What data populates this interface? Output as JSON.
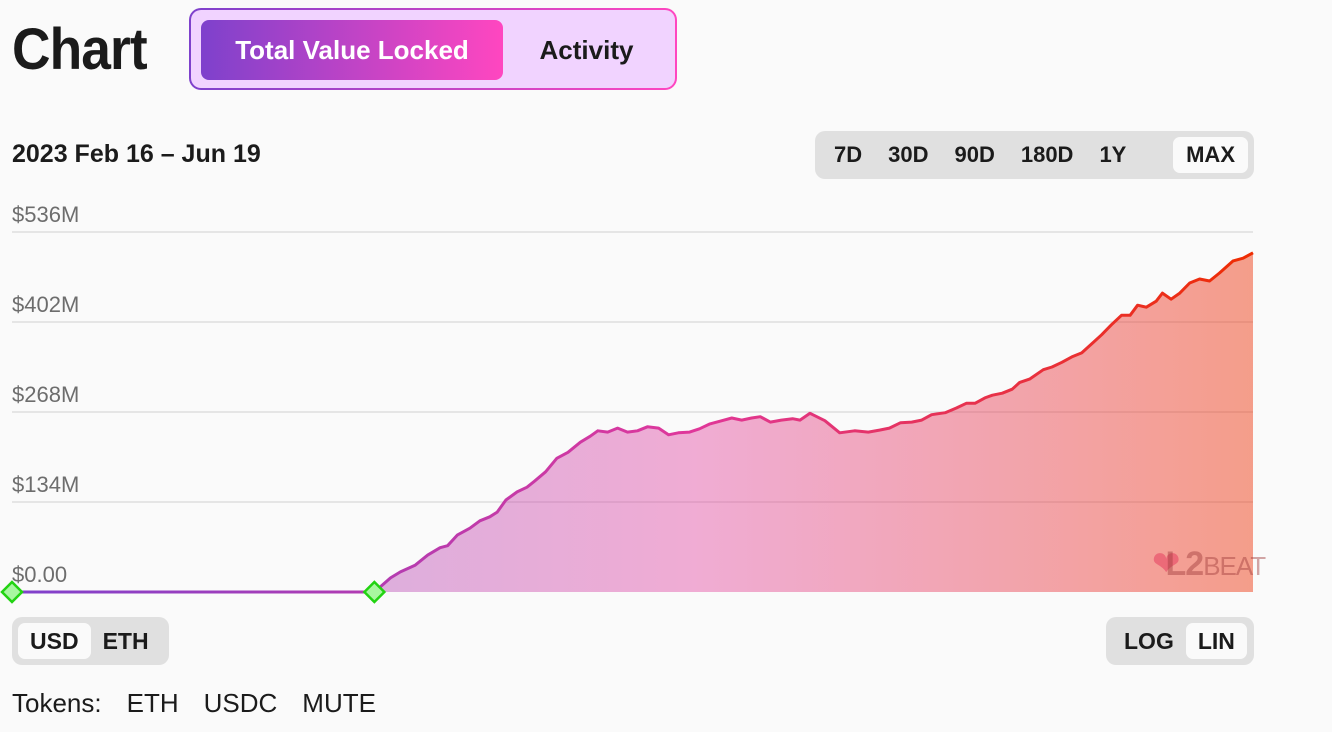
{
  "header": {
    "title": "Chart",
    "tabs": [
      {
        "label": "Total Value Locked",
        "active": true
      },
      {
        "label": "Activity",
        "active": false
      }
    ]
  },
  "date_range": "2023 Feb 16 – Jun 19",
  "range_buttons": [
    {
      "label": "7D",
      "active": false
    },
    {
      "label": "30D",
      "active": false
    },
    {
      "label": "90D",
      "active": false
    },
    {
      "label": "180D",
      "active": false
    },
    {
      "label": "1Y",
      "active": false
    },
    {
      "label": "MAX",
      "active": true
    }
  ],
  "currency_toggle": [
    {
      "label": "USD",
      "active": true
    },
    {
      "label": "ETH",
      "active": false
    }
  ],
  "scale_toggle": [
    {
      "label": "LOG",
      "active": false
    },
    {
      "label": "LIN",
      "active": true
    }
  ],
  "tokens": {
    "label": "Tokens:",
    "items": [
      "ETH",
      "USDC",
      "MUTE"
    ]
  },
  "watermark": "L2BEAT",
  "colors": {
    "gradient_start": "#7e41cc",
    "gradient_mid": "#ff46c0",
    "gradient_end": "#ee2c01",
    "marker_fill": "#a8f7a0",
    "marker_stroke": "#22d312",
    "grid": "#d0d0d0",
    "axis_label": "#6d6d6d"
  },
  "chart_data": {
    "type": "area",
    "title": "Total Value Locked",
    "xlabel": "",
    "ylabel": "",
    "x_range": [
      "2023-02-16",
      "2023-06-19"
    ],
    "ylim": [
      0,
      536
    ],
    "y_unit": "USD millions",
    "y_ticks": [
      {
        "value": 0,
        "label": "$0.00"
      },
      {
        "value": 134,
        "label": "$134M"
      },
      {
        "value": 268,
        "label": "$268M"
      },
      {
        "value": 402,
        "label": "$402M"
      },
      {
        "value": 536,
        "label": "$536M"
      }
    ],
    "grid": true,
    "legend": "none",
    "markers": [
      {
        "x": 0.0,
        "y": 0,
        "label": "milestone"
      },
      {
        "x": 0.292,
        "y": 0,
        "label": "milestone"
      }
    ],
    "series": [
      {
        "name": "TVL",
        "points": [
          [
            0.0,
            0
          ],
          [
            0.292,
            0
          ],
          [
            0.305,
            21
          ],
          [
            0.313,
            30
          ],
          [
            0.325,
            40
          ],
          [
            0.335,
            55
          ],
          [
            0.345,
            66
          ],
          [
            0.351,
            69
          ],
          [
            0.359,
            85
          ],
          [
            0.369,
            95
          ],
          [
            0.377,
            106
          ],
          [
            0.385,
            112
          ],
          [
            0.391,
            119
          ],
          [
            0.398,
            137
          ],
          [
            0.407,
            149
          ],
          [
            0.415,
            156
          ],
          [
            0.421,
            165
          ],
          [
            0.43,
            179
          ],
          [
            0.439,
            199
          ],
          [
            0.448,
            208
          ],
          [
            0.458,
            223
          ],
          [
            0.466,
            232
          ],
          [
            0.472,
            240
          ],
          [
            0.48,
            238
          ],
          [
            0.488,
            244
          ],
          [
            0.496,
            238
          ],
          [
            0.504,
            240
          ],
          [
            0.512,
            246
          ],
          [
            0.521,
            244
          ],
          [
            0.529,
            234
          ],
          [
            0.537,
            237
          ],
          [
            0.546,
            238
          ],
          [
            0.554,
            243
          ],
          [
            0.562,
            250
          ],
          [
            0.572,
            255
          ],
          [
            0.58,
            259
          ],
          [
            0.588,
            256
          ],
          [
            0.596,
            259
          ],
          [
            0.603,
            261
          ],
          [
            0.611,
            253
          ],
          [
            0.62,
            256
          ],
          [
            0.629,
            258
          ],
          [
            0.635,
            256
          ],
          [
            0.643,
            266
          ],
          [
            0.655,
            255
          ],
          [
            0.667,
            237
          ],
          [
            0.679,
            240
          ],
          [
            0.69,
            238
          ],
          [
            0.699,
            241
          ],
          [
            0.707,
            244
          ],
          [
            0.716,
            252
          ],
          [
            0.725,
            253
          ],
          [
            0.733,
            256
          ],
          [
            0.741,
            264
          ],
          [
            0.752,
            267
          ],
          [
            0.761,
            274
          ],
          [
            0.769,
            281
          ],
          [
            0.776,
            281
          ],
          [
            0.784,
            289
          ],
          [
            0.79,
            293
          ],
          [
            0.798,
            296
          ],
          [
            0.806,
            302
          ],
          [
            0.812,
            312
          ],
          [
            0.82,
            317
          ],
          [
            0.831,
            331
          ],
          [
            0.838,
            335
          ],
          [
            0.846,
            342
          ],
          [
            0.854,
            350
          ],
          [
            0.862,
            356
          ],
          [
            0.871,
            371
          ],
          [
            0.878,
            383
          ],
          [
            0.886,
            398
          ],
          [
            0.894,
            412
          ],
          [
            0.901,
            412
          ],
          [
            0.907,
            427
          ],
          [
            0.914,
            424
          ],
          [
            0.922,
            433
          ],
          [
            0.927,
            445
          ],
          [
            0.934,
            436
          ],
          [
            0.941,
            445
          ],
          [
            0.949,
            460
          ],
          [
            0.957,
            466
          ],
          [
            0.965,
            463
          ],
          [
            0.973,
            475
          ],
          [
            0.984,
            493
          ],
          [
            0.992,
            497
          ],
          [
            1.0,
            505
          ]
        ]
      }
    ]
  }
}
